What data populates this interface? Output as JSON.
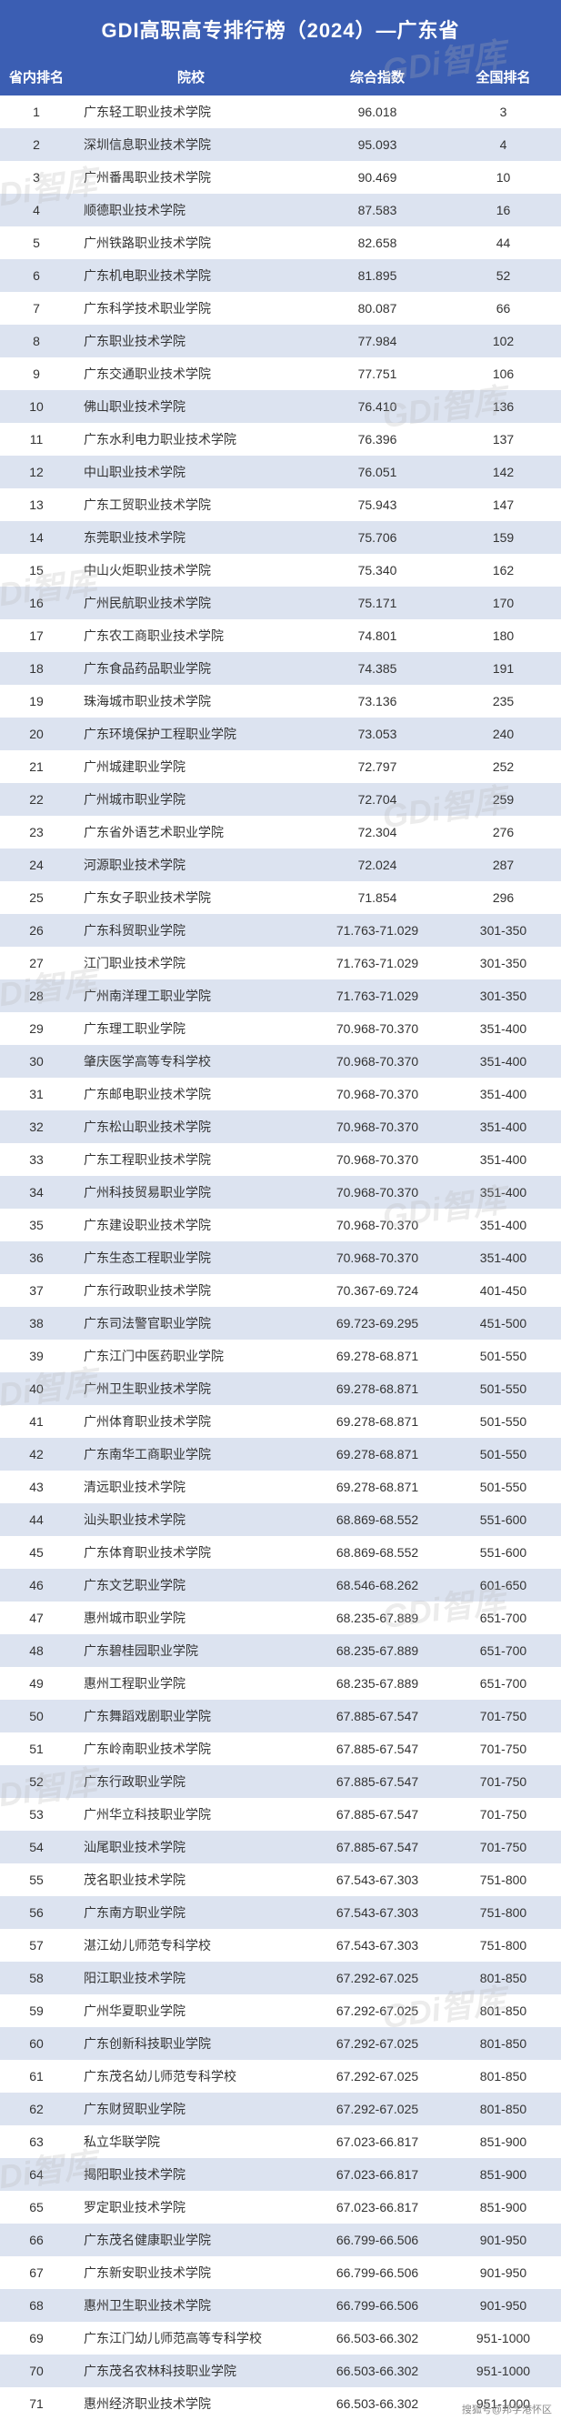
{
  "title": "GDI高职高专排行榜（2024）—广东省",
  "headers": {
    "rank": "省内排名",
    "school": "院校",
    "index": "综合指数",
    "national": "全国排名"
  },
  "watermark_text": "GDi智库",
  "footer": "搜狐号@邦学港怀区",
  "rows": [
    {
      "rank": "1",
      "school": "广东轻工职业技术学院",
      "index": "96.018",
      "national": "3"
    },
    {
      "rank": "2",
      "school": "深圳信息职业技术学院",
      "index": "95.093",
      "national": "4"
    },
    {
      "rank": "3",
      "school": "广州番禺职业技术学院",
      "index": "90.469",
      "national": "10"
    },
    {
      "rank": "4",
      "school": "顺德职业技术学院",
      "index": "87.583",
      "national": "16"
    },
    {
      "rank": "5",
      "school": "广州铁路职业技术学院",
      "index": "82.658",
      "national": "44"
    },
    {
      "rank": "6",
      "school": "广东机电职业技术学院",
      "index": "81.895",
      "national": "52"
    },
    {
      "rank": "7",
      "school": "广东科学技术职业学院",
      "index": "80.087",
      "national": "66"
    },
    {
      "rank": "8",
      "school": "广东职业技术学院",
      "index": "77.984",
      "national": "102"
    },
    {
      "rank": "9",
      "school": "广东交通职业技术学院",
      "index": "77.751",
      "national": "106"
    },
    {
      "rank": "10",
      "school": "佛山职业技术学院",
      "index": "76.410",
      "national": "136"
    },
    {
      "rank": "11",
      "school": "广东水利电力职业技术学院",
      "index": "76.396",
      "national": "137"
    },
    {
      "rank": "12",
      "school": "中山职业技术学院",
      "index": "76.051",
      "national": "142"
    },
    {
      "rank": "13",
      "school": "广东工贸职业技术学院",
      "index": "75.943",
      "national": "147"
    },
    {
      "rank": "14",
      "school": "东莞职业技术学院",
      "index": "75.706",
      "national": "159"
    },
    {
      "rank": "15",
      "school": "中山火炬职业技术学院",
      "index": "75.340",
      "national": "162"
    },
    {
      "rank": "16",
      "school": "广州民航职业技术学院",
      "index": "75.171",
      "national": "170"
    },
    {
      "rank": "17",
      "school": "广东农工商职业技术学院",
      "index": "74.801",
      "national": "180"
    },
    {
      "rank": "18",
      "school": "广东食品药品职业学院",
      "index": "74.385",
      "national": "191"
    },
    {
      "rank": "19",
      "school": "珠海城市职业技术学院",
      "index": "73.136",
      "national": "235"
    },
    {
      "rank": "20",
      "school": "广东环境保护工程职业学院",
      "index": "73.053",
      "national": "240"
    },
    {
      "rank": "21",
      "school": "广州城建职业学院",
      "index": "72.797",
      "national": "252"
    },
    {
      "rank": "22",
      "school": "广州城市职业学院",
      "index": "72.704",
      "national": "259"
    },
    {
      "rank": "23",
      "school": "广东省外语艺术职业学院",
      "index": "72.304",
      "national": "276"
    },
    {
      "rank": "24",
      "school": "河源职业技术学院",
      "index": "72.024",
      "national": "287"
    },
    {
      "rank": "25",
      "school": "广东女子职业技术学院",
      "index": "71.854",
      "national": "296"
    },
    {
      "rank": "26",
      "school": "广东科贸职业学院",
      "index": "71.763-71.029",
      "national": "301-350"
    },
    {
      "rank": "27",
      "school": "江门职业技术学院",
      "index": "71.763-71.029",
      "national": "301-350"
    },
    {
      "rank": "28",
      "school": "广州南洋理工职业学院",
      "index": "71.763-71.029",
      "national": "301-350"
    },
    {
      "rank": "29",
      "school": "广东理工职业学院",
      "index": "70.968-70.370",
      "national": "351-400"
    },
    {
      "rank": "30",
      "school": "肇庆医学高等专科学校",
      "index": "70.968-70.370",
      "national": "351-400"
    },
    {
      "rank": "31",
      "school": "广东邮电职业技术学院",
      "index": "70.968-70.370",
      "national": "351-400"
    },
    {
      "rank": "32",
      "school": "广东松山职业技术学院",
      "index": "70.968-70.370",
      "national": "351-400"
    },
    {
      "rank": "33",
      "school": "广东工程职业技术学院",
      "index": "70.968-70.370",
      "national": "351-400"
    },
    {
      "rank": "34",
      "school": "广州科技贸易职业学院",
      "index": "70.968-70.370",
      "national": "351-400"
    },
    {
      "rank": "35",
      "school": "广东建设职业技术学院",
      "index": "70.968-70.370",
      "national": "351-400"
    },
    {
      "rank": "36",
      "school": "广东生态工程职业学院",
      "index": "70.968-70.370",
      "national": "351-400"
    },
    {
      "rank": "37",
      "school": "广东行政职业技术学院",
      "index": "70.367-69.724",
      "national": "401-450"
    },
    {
      "rank": "38",
      "school": "广东司法警官职业学院",
      "index": "69.723-69.295",
      "national": "451-500"
    },
    {
      "rank": "39",
      "school": "广东江门中医药职业学院",
      "index": "69.278-68.871",
      "national": "501-550"
    },
    {
      "rank": "40",
      "school": "广州卫生职业技术学院",
      "index": "69.278-68.871",
      "national": "501-550"
    },
    {
      "rank": "41",
      "school": "广州体育职业技术学院",
      "index": "69.278-68.871",
      "national": "501-550"
    },
    {
      "rank": "42",
      "school": "广东南华工商职业学院",
      "index": "69.278-68.871",
      "national": "501-550"
    },
    {
      "rank": "43",
      "school": "清远职业技术学院",
      "index": "69.278-68.871",
      "national": "501-550"
    },
    {
      "rank": "44",
      "school": "汕头职业技术学院",
      "index": "68.869-68.552",
      "national": "551-600"
    },
    {
      "rank": "45",
      "school": "广东体育职业技术学院",
      "index": "68.869-68.552",
      "national": "551-600"
    },
    {
      "rank": "46",
      "school": "广东文艺职业学院",
      "index": "68.546-68.262",
      "national": "601-650"
    },
    {
      "rank": "47",
      "school": "惠州城市职业学院",
      "index": "68.235-67.889",
      "national": "651-700"
    },
    {
      "rank": "48",
      "school": "广东碧桂园职业学院",
      "index": "68.235-67.889",
      "national": "651-700"
    },
    {
      "rank": "49",
      "school": "惠州工程职业学院",
      "index": "68.235-67.889",
      "national": "651-700"
    },
    {
      "rank": "50",
      "school": "广东舞蹈戏剧职业学院",
      "index": "67.885-67.547",
      "national": "701-750"
    },
    {
      "rank": "51",
      "school": "广东岭南职业技术学院",
      "index": "67.885-67.547",
      "national": "701-750"
    },
    {
      "rank": "52",
      "school": "广东行政职业学院",
      "index": "67.885-67.547",
      "national": "701-750"
    },
    {
      "rank": "53",
      "school": "广州华立科技职业学院",
      "index": "67.885-67.547",
      "national": "701-750"
    },
    {
      "rank": "54",
      "school": "汕尾职业技术学院",
      "index": "67.885-67.547",
      "national": "701-750"
    },
    {
      "rank": "55",
      "school": "茂名职业技术学院",
      "index": "67.543-67.303",
      "national": "751-800"
    },
    {
      "rank": "56",
      "school": "广东南方职业学院",
      "index": "67.543-67.303",
      "national": "751-800"
    },
    {
      "rank": "57",
      "school": "湛江幼儿师范专科学校",
      "index": "67.543-67.303",
      "national": "751-800"
    },
    {
      "rank": "58",
      "school": "阳江职业技术学院",
      "index": "67.292-67.025",
      "national": "801-850"
    },
    {
      "rank": "59",
      "school": "广州华夏职业学院",
      "index": "67.292-67.025",
      "national": "801-850"
    },
    {
      "rank": "60",
      "school": "广东创新科技职业学院",
      "index": "67.292-67.025",
      "national": "801-850"
    },
    {
      "rank": "61",
      "school": "广东茂名幼儿师范专科学校",
      "index": "67.292-67.025",
      "national": "801-850"
    },
    {
      "rank": "62",
      "school": "广东财贸职业学院",
      "index": "67.292-67.025",
      "national": "801-850"
    },
    {
      "rank": "63",
      "school": "私立华联学院",
      "index": "67.023-66.817",
      "national": "851-900"
    },
    {
      "rank": "64",
      "school": "揭阳职业技术学院",
      "index": "67.023-66.817",
      "national": "851-900"
    },
    {
      "rank": "65",
      "school": "罗定职业技术学院",
      "index": "67.023-66.817",
      "national": "851-900"
    },
    {
      "rank": "66",
      "school": "广东茂名健康职业学院",
      "index": "66.799-66.506",
      "national": "901-950"
    },
    {
      "rank": "67",
      "school": "广东新安职业技术学院",
      "index": "66.799-66.506",
      "national": "901-950"
    },
    {
      "rank": "68",
      "school": "惠州卫生职业技术学院",
      "index": "66.799-66.506",
      "national": "901-950"
    },
    {
      "rank": "69",
      "school": "广东江门幼儿师范高等专科学校",
      "index": "66.503-66.302",
      "national": "951-1000"
    },
    {
      "rank": "70",
      "school": "广东茂名农林科技职业学院",
      "index": "66.503-66.302",
      "national": "951-1000"
    },
    {
      "rank": "71",
      "school": "惠州经济职业技术学院",
      "index": "66.503-66.302",
      "national": "951-1000"
    }
  ]
}
